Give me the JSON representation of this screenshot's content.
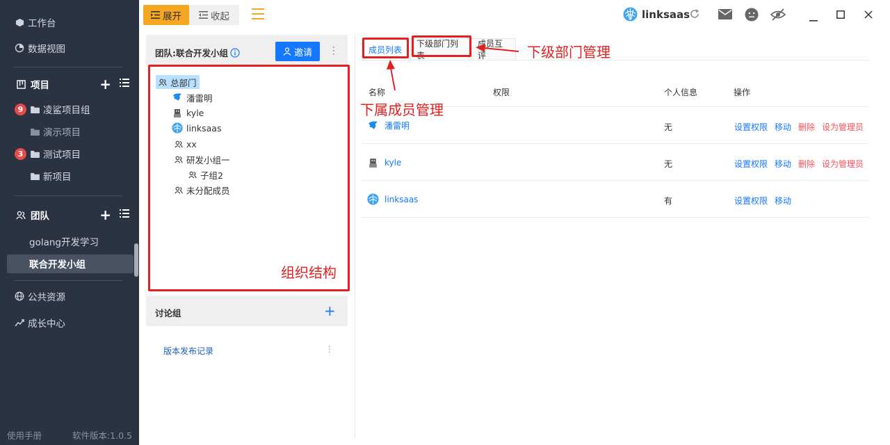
{
  "sidebar": {
    "workbench": "工作台",
    "data_view": "数据视图",
    "project_section": "项目",
    "project_groups": [
      {
        "badge": "9",
        "label": "凌鲨项目组"
      },
      {
        "badge": "",
        "label": "演示项目"
      },
      {
        "badge": "3",
        "label": "测试项目"
      },
      {
        "badge": "",
        "label": "新项目"
      }
    ],
    "team_section": "团队",
    "teams": [
      "golang开发学习",
      "联合开发小组"
    ],
    "public_resources": "公共资源",
    "growth_center": "成长中心",
    "footer_manual": "使用手册",
    "footer_version": "软件版本:1.0.5"
  },
  "topbar": {
    "expand": "展开",
    "collapse": "收起",
    "brand": "linksaas"
  },
  "team_panel": {
    "title": "团队:联合开发小组",
    "invite": "邀请",
    "tree": [
      {
        "label": "总部门",
        "type": "dept"
      },
      {
        "label": "潘雷明",
        "type": "member"
      },
      {
        "label": "kyle",
        "type": "member"
      },
      {
        "label": "linksaas",
        "type": "member"
      },
      {
        "label": "xx",
        "type": "dept"
      },
      {
        "label": "研发小组一",
        "type": "dept"
      },
      {
        "label": "子组2",
        "type": "dept"
      },
      {
        "label": "未分配成员",
        "type": "dept"
      }
    ]
  },
  "discussion": {
    "title": "讨论组",
    "items": [
      "版本发布记录"
    ]
  },
  "tabs": [
    "成员列表",
    "下级部门列表",
    "成员互评"
  ],
  "table": {
    "headers": [
      "名称",
      "权限",
      "个人信息",
      "操作"
    ],
    "rows": [
      {
        "name": "潘雷明",
        "info": "无",
        "ops": [
          "设置权限",
          "移动",
          "删除",
          "设为管理员"
        ]
      },
      {
        "name": "kyle",
        "info": "无",
        "ops": [
          "设置权限",
          "移动",
          "删除",
          "设为管理员"
        ]
      },
      {
        "name": "linksaas",
        "info": "有",
        "ops": [
          "设置权限",
          "移动"
        ]
      }
    ]
  },
  "annotations": {
    "org_structure": "组织结构",
    "member_mgmt": "下属成员管理",
    "dept_mgmt": "下级部门管理"
  },
  "colors": {
    "accent": "#1677ff",
    "expand": "#f5a623",
    "annotation": "#e32020",
    "sidebar": "#2b3242"
  }
}
